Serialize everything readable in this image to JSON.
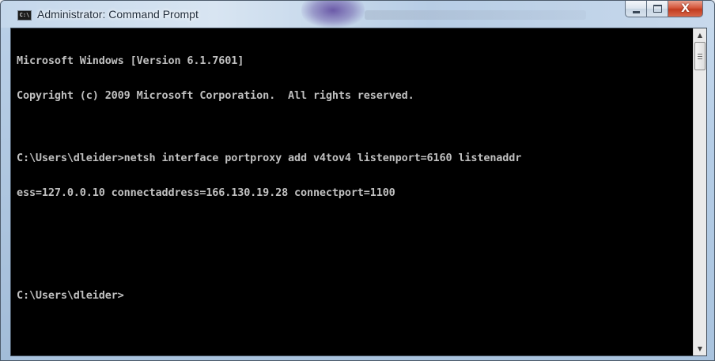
{
  "window": {
    "title": "Administrator: Command Prompt",
    "app_icon_text": "C:\\",
    "controls": {
      "minimize": "minimize",
      "maximize": "maximize",
      "close": "X"
    }
  },
  "console": {
    "lines": [
      "Microsoft Windows [Version 6.1.7601]",
      "Copyright (c) 2009 Microsoft Corporation.  All rights reserved.",
      "",
      "C:\\Users\\dleider>netsh interface portproxy add v4tov4 listenport=6160 listenaddr",
      "ess=127.0.0.10 connectaddress=166.130.19.28 connectport=1100",
      "",
      "",
      "C:\\Users\\dleider>"
    ]
  },
  "scrollbar": {
    "up_arrow": "▲",
    "down_arrow": "▼"
  },
  "colors": {
    "console_bg": "#000000",
    "console_fg": "#c0c0c0",
    "close_red": "#c23c20",
    "title_glass": "#c4d7eb"
  }
}
